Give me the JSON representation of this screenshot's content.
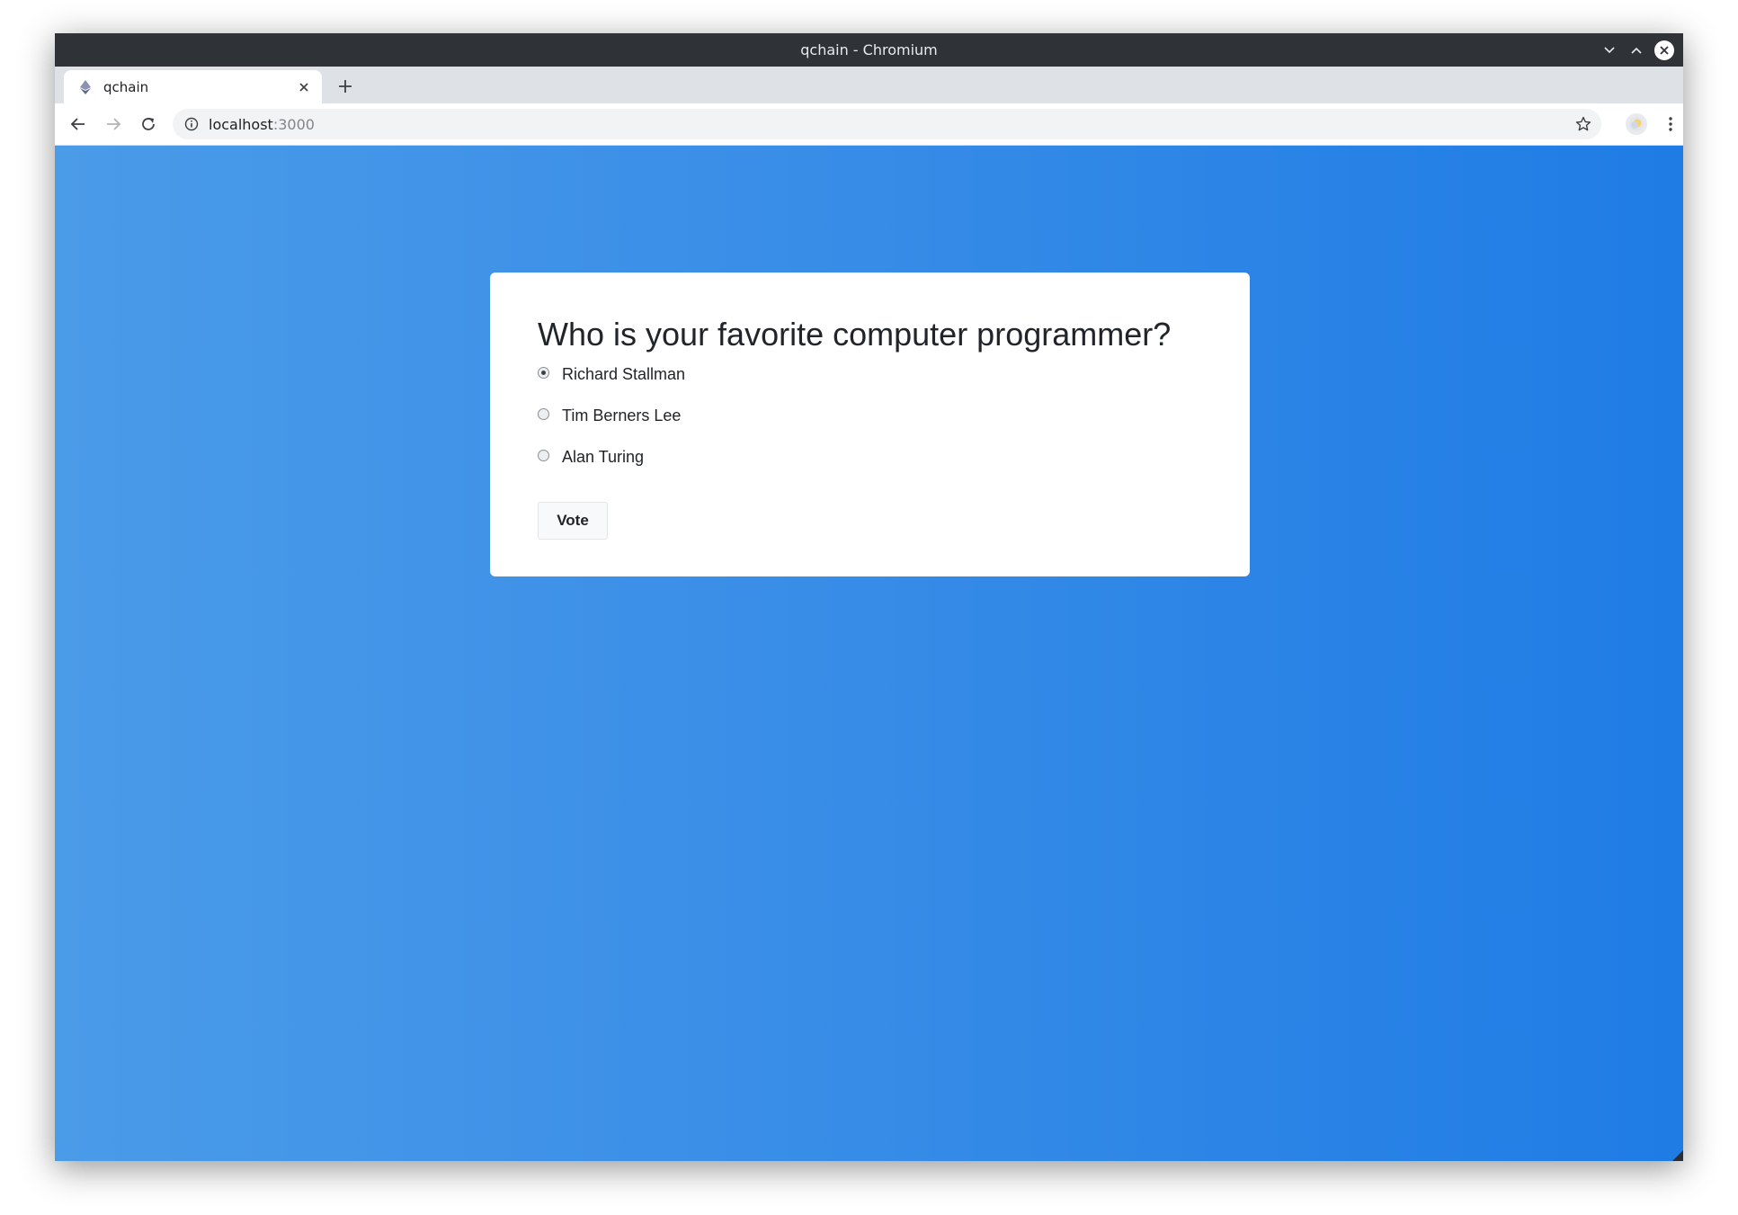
{
  "window": {
    "title": "qchain - Chromium"
  },
  "tab": {
    "title": "qchain"
  },
  "address": {
    "host": "localhost",
    "port": ":3000"
  },
  "poll": {
    "question": "Who is your favorite computer programmer?",
    "options": [
      {
        "label": "Richard Stallman",
        "selected": true
      },
      {
        "label": "Tim Berners Lee",
        "selected": false
      },
      {
        "label": "Alan Turing",
        "selected": false
      }
    ],
    "vote_label": "Vote"
  },
  "colors": {
    "background_gradient_start": "#4a9be8",
    "background_gradient_end": "#1f7ce5",
    "titlebar": "#2f3337",
    "card": "#ffffff"
  },
  "icons": {
    "favicon": "ethereum-icon",
    "back": "arrow-left-icon",
    "forward": "arrow-right-icon",
    "reload": "reload-icon",
    "info": "info-icon",
    "bookmark": "star-icon",
    "profile": "avatar-icon",
    "menu": "kebab-menu-icon"
  }
}
